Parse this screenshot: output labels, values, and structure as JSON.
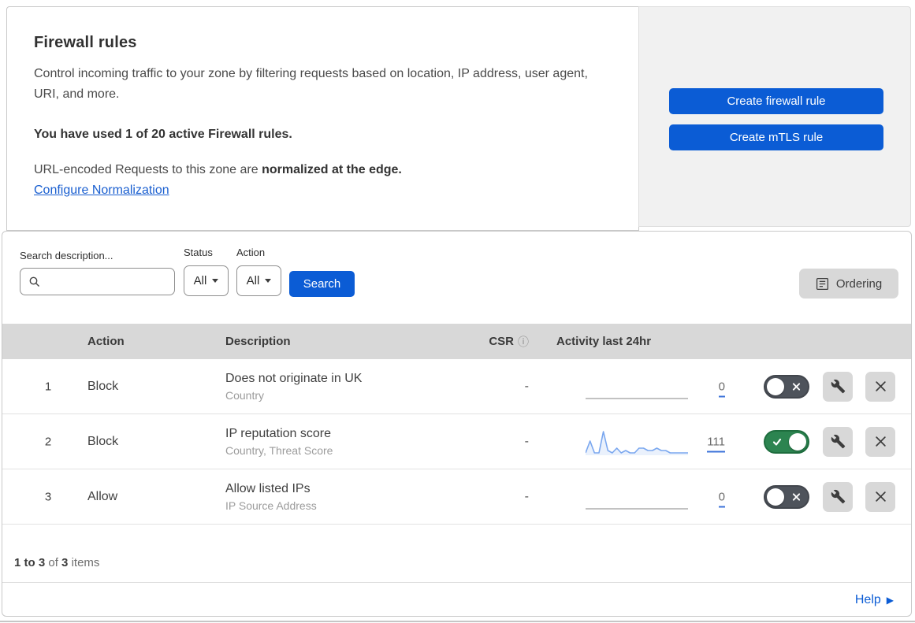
{
  "header": {
    "title": "Firewall rules",
    "description": "Control incoming traffic to your zone by filtering requests based on location, IP address, user agent, URI, and more.",
    "usage_bold": "You have used 1 of 20 active Firewall rules.",
    "normalization_text": "URL-encoded Requests to this zone are ",
    "normalization_bold": "normalized at the edge.",
    "normalization_link": "Configure Normalization"
  },
  "actions_panel": {
    "create_firewall_rule": "Create firewall rule",
    "create_mtls_rule": "Create mTLS rule"
  },
  "filters": {
    "search_label": "Search description...",
    "search_value": "",
    "status_label": "Status",
    "status_value": "All",
    "action_label": "Action",
    "action_value": "All",
    "search_button": "Search",
    "ordering_button": "Ordering"
  },
  "table": {
    "columns": {
      "action": "Action",
      "description": "Description",
      "csr": "CSR",
      "csr_info_icon": "ⓘ",
      "activity": "Activity last 24hr"
    },
    "rows": [
      {
        "index": "1",
        "action": "Block",
        "description": "Does not originate in UK",
        "fields": "Country",
        "csr": "-",
        "count": "0",
        "enabled": false,
        "spark": null
      },
      {
        "index": "2",
        "action": "Block",
        "description": "IP reputation score",
        "fields": "Country, Threat Score",
        "csr": "-",
        "count": "111",
        "enabled": true,
        "spark": [
          1,
          6,
          1,
          1,
          10,
          2,
          1,
          3,
          1,
          2,
          1,
          1,
          3,
          3,
          2,
          2,
          3,
          2,
          2,
          1,
          1,
          1,
          1,
          1
        ]
      },
      {
        "index": "3",
        "action": "Allow",
        "description": "Allow listed IPs",
        "fields": "IP Source Address",
        "csr": "-",
        "count": "0",
        "enabled": false,
        "spark": null
      }
    ]
  },
  "footer": {
    "range_bold": "1 to 3",
    "of_text": "of",
    "total_bold": "3",
    "items_text": "items",
    "help_link": "Help",
    "help_arrow": "▶"
  },
  "colors": {
    "primary_blue": "#0b5cd5",
    "link_blue": "#1a5fd0",
    "toggle_green": "#2c8450",
    "toggle_gray": "#4e535b",
    "spark_blue": "#7aa7ef",
    "header_gray": "#d8d8d8",
    "panel_gray": "#f1f1f1"
  },
  "chart_data": {
    "type": "line",
    "title": "Activity last 24hr sparkline (rule 2)",
    "x": [
      0,
      1,
      2,
      3,
      4,
      5,
      6,
      7,
      8,
      9,
      10,
      11,
      12,
      13,
      14,
      15,
      16,
      17,
      18,
      19,
      20,
      21,
      22,
      23
    ],
    "values": [
      1,
      6,
      1,
      1,
      10,
      2,
      1,
      3,
      1,
      2,
      1,
      1,
      3,
      3,
      2,
      2,
      3,
      2,
      2,
      1,
      1,
      1,
      1,
      1
    ],
    "total_label": "111"
  }
}
